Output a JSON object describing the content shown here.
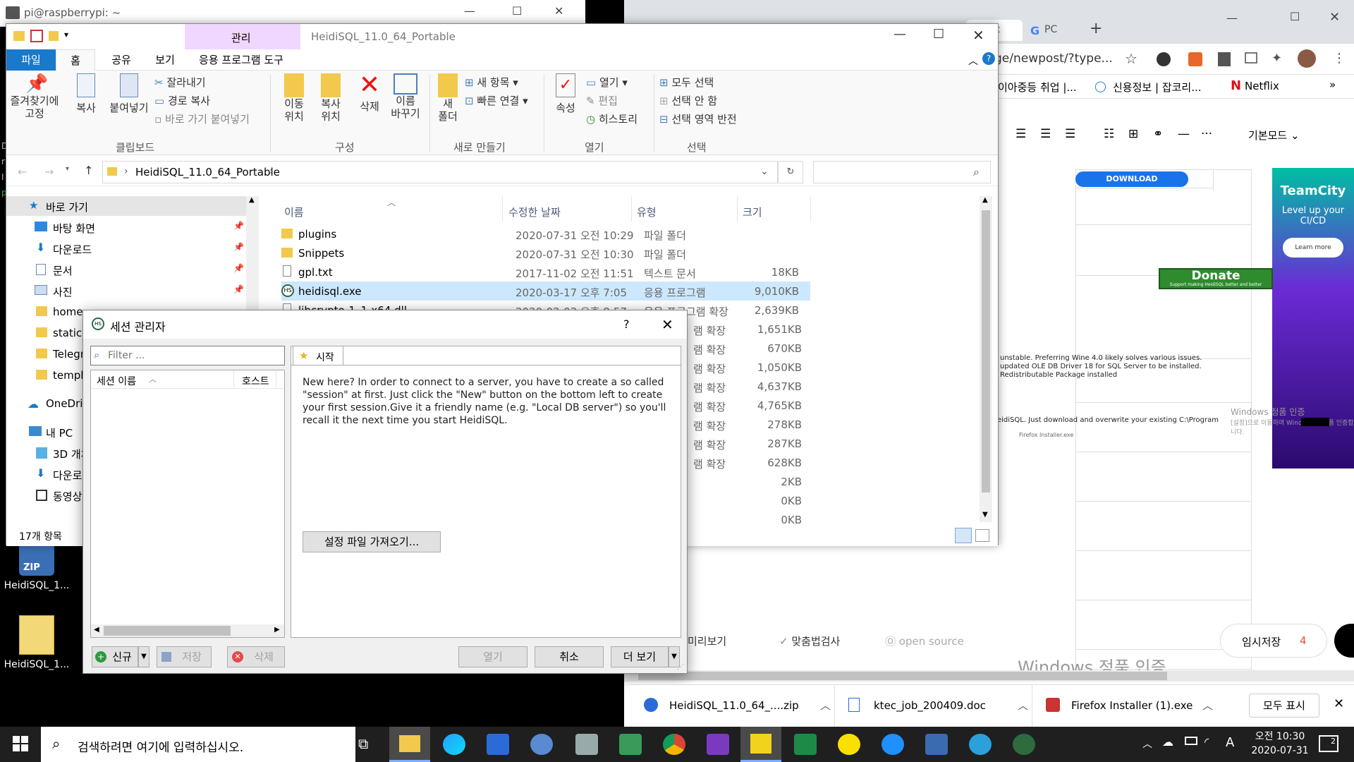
{
  "terminal": {
    "title": "pi@raspberrypi: ~"
  },
  "desktop": {
    "icons": [
      {
        "label": "HeidiSQL_1...",
        "badge": "ZIP"
      },
      {
        "label": "HeidiSQL_1..."
      }
    ]
  },
  "browser": {
    "tabs": [
      "Dc",
      "PC"
    ],
    "url": "ge/newpost/?type...",
    "bookmarks": [
      "이아중등 취업 |...",
      "신용정보 | 잡코리...",
      "Netflix"
    ],
    "editor_mode": "기본모드",
    "ad_download": "DOWNLOAD",
    "ad_teamcity": {
      "title": "TeamCity",
      "sub": "Level up your CI/CD",
      "btn": "Learn more"
    },
    "donate": "Donate",
    "donate_sub": "Support making HeidiSQL better and better",
    "content_lines": [
      "unstable. Preferring Wine 4.0 likely solves various issues.",
      "updated OLE DB Driver 18 for SQL Server to be installed.",
      "Redistributable Package installed",
      "eidiSQL. Just download and overwrite your existing C:\\Program"
    ],
    "inline_download": "Firefox Installer.exe",
    "bottom_tools": {
      "preview": "미리보기",
      "spell": "맞춤법검사",
      "open_source": "open source",
      "draft": "임시저장",
      "draft_count": "4"
    }
  },
  "watermark": {
    "title": "Windows 정품 인증",
    "sub": "[설정]으로 이동하여 Windows를 정품 인증합니다."
  },
  "watermark_small": {
    "title": "Windows 정품 인증",
    "sub": "[설정]으로 이동하여 Windows를 정품 인증합니다."
  },
  "explorer": {
    "title": "HeidiSQL_11.0_64_Portable",
    "manage_tab": "관리",
    "tabs": [
      "파일",
      "홈",
      "공유",
      "보기",
      "응용 프로그램 도구"
    ],
    "ribbon": {
      "clipboard": {
        "pin": "즐겨찾기에\n고정",
        "copy": "복사",
        "paste": "붙여넣기",
        "cut": "잘라내기",
        "copy_path": "경로 복사",
        "paste_shortcut": "바로 가기 붙여넣기",
        "group": "클립보드"
      },
      "organize": {
        "move": "이동\n위치",
        "copyto": "복사\n위치",
        "delete": "삭제",
        "rename": "이름\n바꾸기",
        "group": "구성"
      },
      "new": {
        "folder": "새\n폴더",
        "item": "새 항목",
        "easy": "빠른 연결",
        "group": "새로 만들기"
      },
      "open": {
        "props": "속성",
        "open": "열기",
        "edit": "편집",
        "history": "히스토리",
        "group": "열기"
      },
      "select": {
        "all": "모두 선택",
        "none": "선택 안 함",
        "invert": "선택 영역 반전",
        "group": "선택"
      }
    },
    "address": "HeidiSQL_11.0_64_Portable",
    "nav": [
      "바로 가기",
      "바탕 화면",
      "다운로드",
      "문서",
      "사진",
      "home",
      "static",
      "Telegra",
      "templa",
      "OneDriv",
      "내 PC",
      "3D 개체",
      "다운로",
      "동영상"
    ],
    "columns": {
      "name": "이름",
      "date": "수정한 날짜",
      "type": "유형",
      "size": "크기"
    },
    "files": [
      {
        "name": "plugins",
        "date": "2020-07-31 오전 10:29",
        "type": "파일 폴더",
        "size": ""
      },
      {
        "name": "Snippets",
        "date": "2020-07-31 오전 10:30",
        "type": "파일 폴더",
        "size": ""
      },
      {
        "name": "gpl.txt",
        "date": "2017-11-02 오전 11:51",
        "type": "텍스트 문서",
        "size": "18KB"
      },
      {
        "name": "heidisql.exe",
        "date": "2020-03-17 오후 7:05",
        "type": "응용 프로그램",
        "size": "9,010KB"
      },
      {
        "name": "libcrypto-1_1-x64.dll",
        "date": "2020-02-03 오후 8:57",
        "type": "응용 프로그램 확장",
        "size": "2,639KB"
      }
    ],
    "hidden_rows": [
      {
        "type": "램 확장",
        "size": "1,651KB"
      },
      {
        "type": "램 확장",
        "size": "670KB"
      },
      {
        "type": "램 확장",
        "size": "1,050KB"
      },
      {
        "type": "램 확장",
        "size": "4,637KB"
      },
      {
        "type": "램 확장",
        "size": "4,765KB"
      },
      {
        "type": "램 확장",
        "size": "278KB"
      },
      {
        "type": "램 확장",
        "size": "287KB"
      },
      {
        "type": "램 확장",
        "size": "628KB"
      },
      {
        "type": "",
        "size": "2KB"
      },
      {
        "type": "",
        "size": "0KB"
      },
      {
        "type": "",
        "size": "0KB"
      }
    ],
    "status": "17개 항목"
  },
  "dialog": {
    "title": "세션 관리자",
    "help": "?",
    "filter_placeholder": "Filter ...",
    "col_session": "세션 이름",
    "col_host": "호스트",
    "tab_start": "시작",
    "intro": "New here? In order to connect to a server, you have to create a so called \"session\" at first. Just click the \"New\" button on the bottom left to create your first session.Give it a friendly name (e.g. \"Local DB server\") so you'll recall it the next time you start HeidiSQL.",
    "import_btn": "설정 파일 가져오기...",
    "btn_new": "신규",
    "btn_save": "저장",
    "btn_delete": "삭제",
    "btn_open": "열기",
    "btn_cancel": "취소",
    "btn_more": "더 보기"
  },
  "downloads": [
    {
      "name": "HeidiSQL_11.0_64_....zip"
    },
    {
      "name": "ktec_job_200409.doc"
    },
    {
      "name": "Firefox Installer (1).exe"
    }
  ],
  "downloads_showall": "모두 표시",
  "taskbar": {
    "search": "검색하려면 여기에 입력하십시오.",
    "time": "오전 10:30",
    "date": "2020-07-31",
    "lang": "A",
    "notif": "2"
  }
}
